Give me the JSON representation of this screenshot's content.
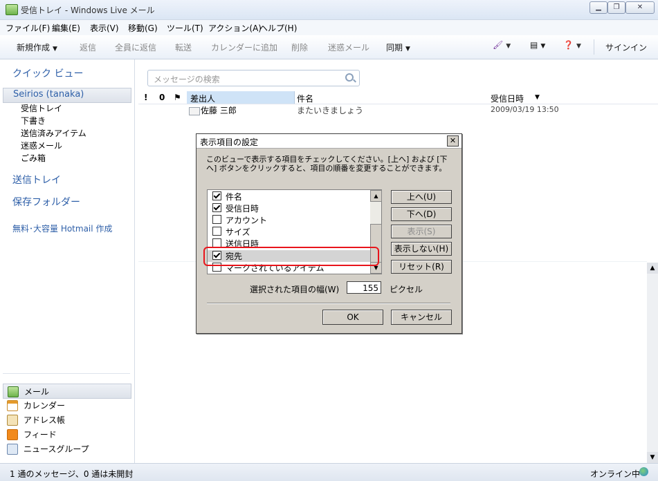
{
  "window": {
    "title": "受信トレイ - Windows Live メール"
  },
  "menu": [
    "ファイル(F)",
    "編集(E)",
    "表示(V)",
    "移動(G)",
    "ツール(T)",
    "アクション(A)",
    "ヘルプ(H)"
  ],
  "toolbar": {
    "new": "新規作成",
    "reply": "返信",
    "reply_all": "全員に返信",
    "forward": "転送",
    "add_calendar": "カレンダーに追加",
    "delete": "削除",
    "junk": "迷惑メール",
    "sync": "同期",
    "sign_in": "サインイン"
  },
  "sidebar": {
    "quick_views": "クイック ビュー",
    "account": "Seirios (tanaka)",
    "folders": [
      "受信トレイ",
      "下書き",
      "送信済みアイテム",
      "迷惑メール",
      "ごみ箱"
    ],
    "outbox": "送信トレイ",
    "storage_folders": "保存フォルダー",
    "hotmail_link": "無料･大容量 Hotmail 作成",
    "nav": [
      "メール",
      "カレンダー",
      "アドレス帳",
      "フィード",
      "ニュースグループ"
    ]
  },
  "search": {
    "placeholder": "メッセージの検索"
  },
  "list": {
    "columns": {
      "importance": "!",
      "attachment": "0",
      "flag": "⚑",
      "from": "差出人",
      "subject": "件名",
      "received": "受信日時"
    },
    "rows": [
      {
        "from": "佐藤 三郎",
        "subject": "またいきましょう",
        "received": "2009/03/19 13:50"
      }
    ]
  },
  "status": {
    "message": "1 通のメッセージ、0 通は未開封",
    "online": "オンライン中"
  },
  "dialog": {
    "title": "表示項目の設定",
    "description": "このビューで表示する項目をチェックしてください。[上へ] および [下へ] ボタンをクリックすると、項目の順番を変更することができます。",
    "items": [
      {
        "label": "件名",
        "checked": true
      },
      {
        "label": "受信日時",
        "checked": true
      },
      {
        "label": "アカウント",
        "checked": false
      },
      {
        "label": "サイズ",
        "checked": false
      },
      {
        "label": "送信日時",
        "checked": false
      },
      {
        "label": "宛先",
        "checked": true
      },
      {
        "label": "マークされているアイテム",
        "checked": false
      }
    ],
    "buttons": {
      "up": "上へ(U)",
      "down": "下へ(D)",
      "show": "表示(S)",
      "hide": "表示しない(H)",
      "reset": "リセット(R)",
      "ok": "OK",
      "cancel": "キャンセル"
    },
    "width_label": "選択された項目の幅(W)",
    "width_value": "155",
    "pixel_label": "ピクセル"
  },
  "colors": {
    "accent": "#2e5fa8",
    "highlight": "#e8141b",
    "column_selected": "#cfe3f7"
  }
}
